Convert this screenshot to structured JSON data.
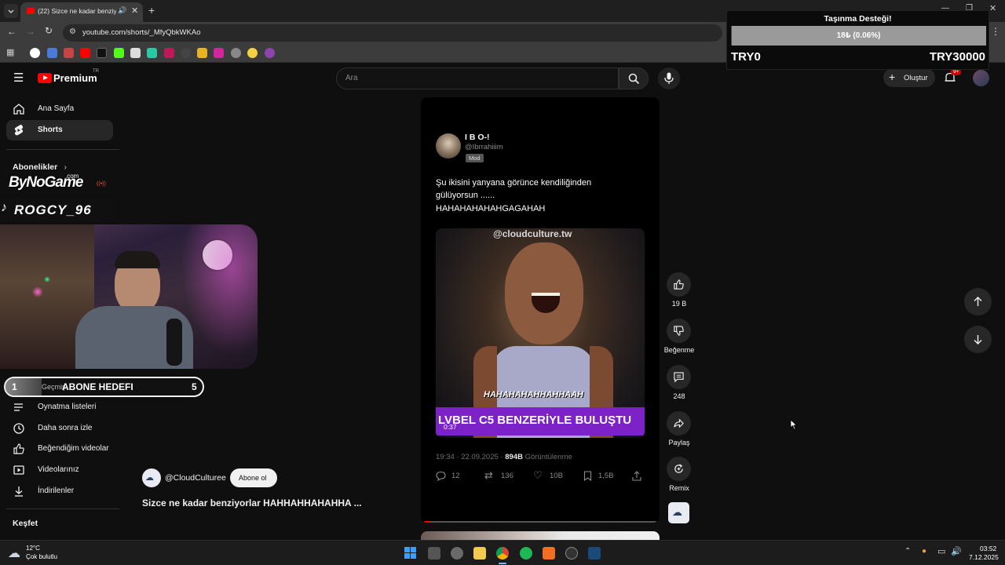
{
  "browser": {
    "tab_title": "(22) Sizce ne kadar benziyo",
    "url": "youtube.com/shorts/_MfyQbkWKAo"
  },
  "youtube": {
    "logo_text": "Premium",
    "logo_region": "TR",
    "search_placeholder": "Ara",
    "create_label": "Oluştur",
    "notif_count": "9+"
  },
  "sidebar": {
    "home": "Ana Sayfa",
    "shorts": "Shorts",
    "subscriptions_heading": "Abonelikler",
    "playlists": "Oynatma listeleri",
    "watch_later": "Daha sonra izle",
    "liked": "Beğendiğim videolar",
    "your_videos": "Videolarınız",
    "downloads": "İndirilenler",
    "explore_heading": "Keşfet",
    "history_partial": "Geçmiş"
  },
  "overlays": {
    "watermark_site": "ByNoGame",
    "watermark_site_suffix": ".com",
    "tiktok_handle": "ROGCY_96",
    "sub_goal_current": "1",
    "sub_goal_label": "ABONE HEDEFI",
    "sub_goal_target": "5",
    "donation_title": "Taşınma Desteği!",
    "donation_progress_text": "18₺ (0.06%)",
    "donation_progress_pct": 0.06,
    "donation_min": "TRY0",
    "donation_max": "TRY30000"
  },
  "short": {
    "tweet_name": "I B O-!",
    "tweet_handle": "@Ibrrahiiim",
    "tweet_badge": "Mod",
    "tweet_text_line1": "Şu ikisini yanyana görünce kendiliğinden",
    "tweet_text_line2": "gülüyorsun ......",
    "tweet_text_line3": "HAHAHAHAHAHGAGAHAH",
    "video_watermark": "@cloudculture.tw",
    "video_caption": "HAHAHAHAHHAHHAAH",
    "video_banner": "LVBEL C5 BENZERİYLE BULUŞTU",
    "video_duration": "0:37",
    "tweet_time": "19:34 · 22.09.2025 · ",
    "tweet_views": "894B",
    "tweet_views_label": " Görüntülenme",
    "replies": "12",
    "retweets": "136",
    "likes": "10B",
    "bookmarks": "1,5B",
    "channel": "@CloudCulturee",
    "subscribe_label": "Abone ol",
    "title": "Sizce ne kadar benziyorlar HAHHAHHAHAHHA ..."
  },
  "actions": {
    "like_count": "19 B",
    "dislike_label": "Beğenme",
    "comment_count": "248",
    "share_label": "Paylaş",
    "remix_label": "Remix"
  },
  "taskbar": {
    "weather_temp": "12°C",
    "weather_desc": "Çok bulutlu",
    "time": "03:52",
    "date": "7.12.2025"
  }
}
